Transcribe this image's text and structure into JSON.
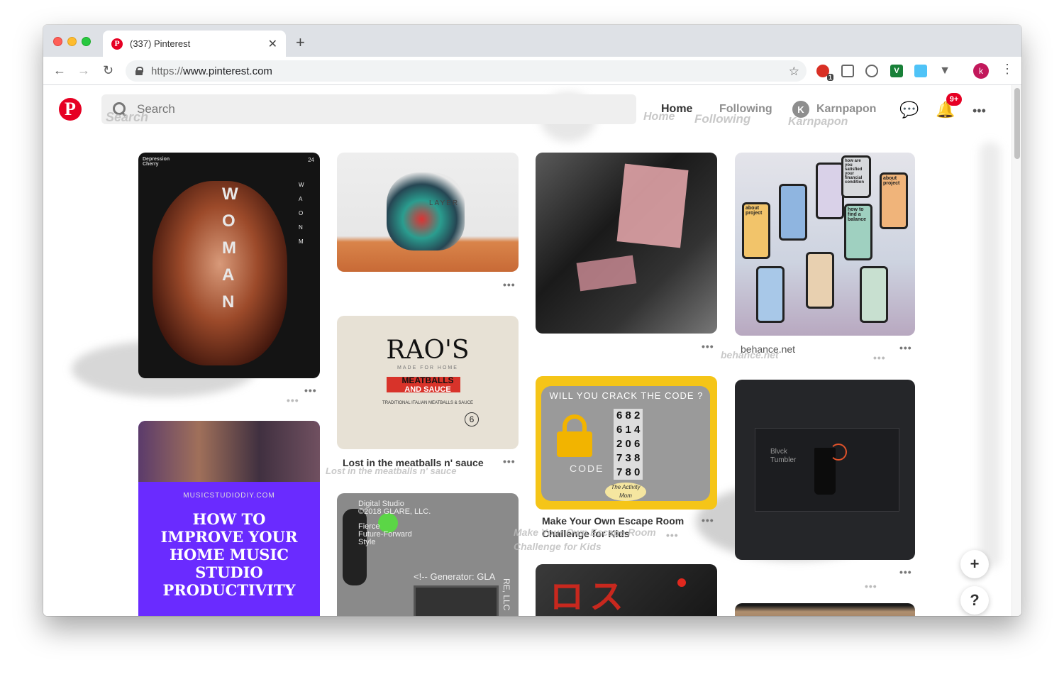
{
  "browser": {
    "tab_title": "(337) Pinterest",
    "tab_favicon": "P",
    "new_tab": "+",
    "url_scheme": "https://",
    "url_host": "www.pinterest.com",
    "profile_initial": "k",
    "extension_badge": "1",
    "ext_v_label": "V"
  },
  "header": {
    "logo": "P",
    "search_placeholder": "Search",
    "ghost_search": "Search",
    "nav_home": "Home",
    "nav_following": "Following",
    "ghost_home": "Home",
    "ghost_following": "Following",
    "user_initial": "K",
    "user_name": "Karnpapon",
    "ghost_user": "Karnpapon",
    "notifications_badge": "9+"
  },
  "pins": {
    "woman": {
      "top": "Depression",
      "sub": "Cherry",
      "num": "24",
      "letters": [
        "W",
        "O",
        "M",
        "A",
        "N"
      ],
      "side": [
        "W",
        "A",
        "O",
        "N",
        "M"
      ]
    },
    "bag": {
      "label": "LAYER"
    },
    "meatballs": {
      "brand": "RAO'S",
      "made": "MADE FOR HOME",
      "line1": "MEATBALLS",
      "line2": "AND SAUCE",
      "line3": "TRADITIONAL ITALIAN MEATBALLS & SAUCE",
      "count": "6",
      "title": "Lost in the meatballs n' sauce",
      "ghost_title": "Lost in the meatballs n' sauce"
    },
    "behance": {
      "source": "behance.net",
      "ghost_source": "behance.net",
      "p1": "about project",
      "p2": "how to find a balance",
      "p3": "about project",
      "p4": "how are you satisfied your financial condition"
    },
    "escape": {
      "header": "WILL YOU CRACK THE CODE ?",
      "codes": [
        "6 8 2",
        "6 1 4",
        "2 0 6",
        "7 3 8",
        "7 8 0"
      ],
      "word": "CODE",
      "brand": "The Activity Mom",
      "title_line1": "Make Your Own Escape Room",
      "title_line2": "Challenge for Kids",
      "ghost_line1": "Make Your Own Escape Room",
      "ghost_line2": "Challenge for Kids"
    },
    "tumbler": {
      "name": "Blvck Tumbler"
    },
    "music": {
      "site": "MUSICSTUDIODIY.COM",
      "line1": "HOW TO",
      "line2": "IMPROVE YOUR",
      "line3": "HOME MUSIC",
      "line4": "STUDIO",
      "line5": "PRODUCTIVITY"
    },
    "glare": {
      "l1": "Digital Studio",
      "l2": "©2018 GLARE, LLC.",
      "l3": "Fierce",
      "l4": "Future-Forward",
      "l5": "Style",
      "l6": "<!-- Generator: GLA",
      "side": "RE, LLC"
    },
    "red": {
      "glyph": "ロス"
    }
  },
  "fab": {
    "add": "+",
    "help": "?"
  },
  "more_dots": "•••",
  "colors": {
    "pinterest_red": "#e60023",
    "music_purple": "#6a2bff",
    "escape_yellow": "#f5c518"
  }
}
